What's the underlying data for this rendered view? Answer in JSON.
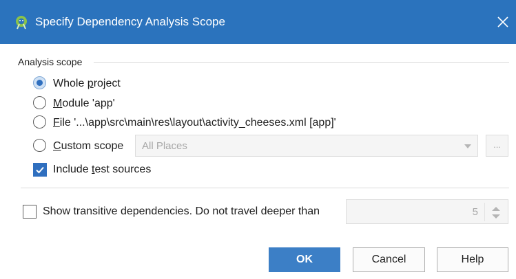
{
  "dialog": {
    "title": "Specify Dependency Analysis Scope",
    "accent_color": "#2b73bd"
  },
  "scope_group": {
    "label": "Analysis scope",
    "options": [
      {
        "label": "Whole project",
        "checked": true
      },
      {
        "label": "Module 'app'",
        "checked": false
      },
      {
        "label": "File '...\\app\\src\\main\\res\\layout\\activity_cheeses.xml [app]'",
        "checked": false
      },
      {
        "label": "Custom scope",
        "checked": false
      }
    ],
    "custom_scope_value": "All Places",
    "browse_label": "...",
    "include_tests": {
      "label": "Include test sources",
      "checked": true
    }
  },
  "transitive": {
    "label": "Show transitive dependencies. Do not travel deeper than",
    "checked": false,
    "depth": "5"
  },
  "buttons": {
    "ok": "OK",
    "cancel": "Cancel",
    "help": "Help"
  },
  "icons": {
    "app": "android-studio-icon",
    "close": "close-icon"
  }
}
